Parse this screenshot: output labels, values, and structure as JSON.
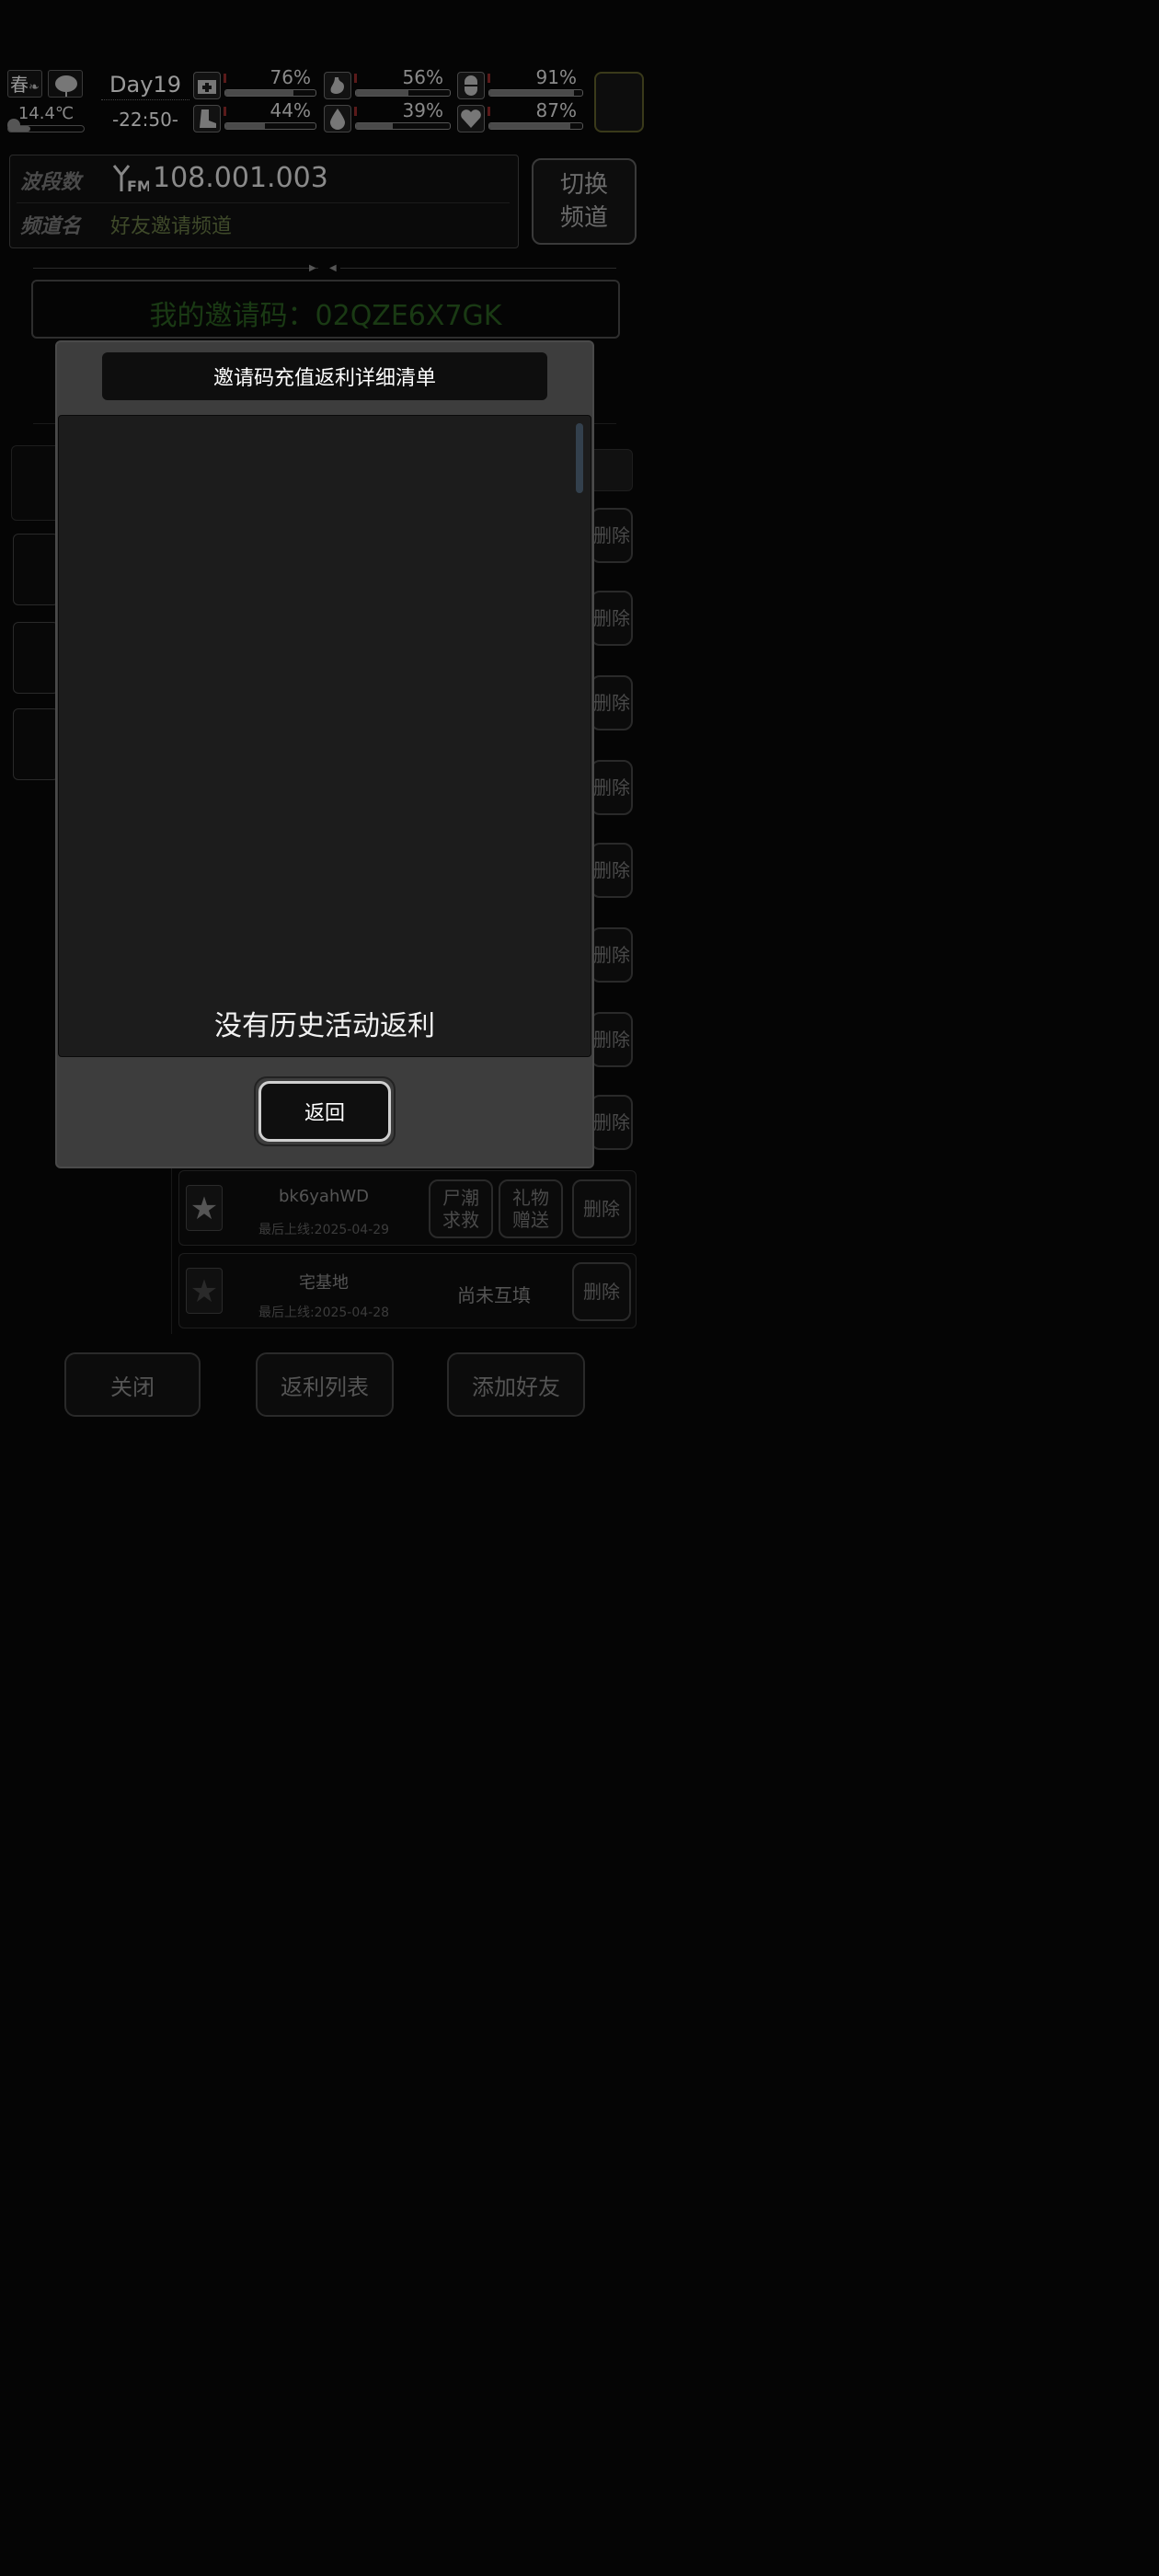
{
  "hud": {
    "season": "春",
    "temperature": "14.4℃",
    "day": "Day19",
    "time": "-22:50-",
    "stats": [
      {
        "icon": "medkit-icon",
        "value": "76%",
        "level": 0.76
      },
      {
        "icon": "stomach-icon",
        "value": "56%",
        "level": 0.56
      },
      {
        "icon": "pill-icon",
        "value": "91%",
        "level": 0.91
      },
      {
        "icon": "boot-icon",
        "value": "44%",
        "level": 0.44
      },
      {
        "icon": "water-drop-icon",
        "value": "39%",
        "level": 0.39
      },
      {
        "icon": "heart-icon",
        "value": "87%",
        "level": 0.87
      }
    ]
  },
  "channel": {
    "freq_label": "波段数",
    "freq_value": "108.001.003",
    "name_label": "频道名",
    "name_value": "好友邀请频道",
    "switch_line1": "切换",
    "switch_line2": "频道"
  },
  "invite": {
    "text": "我的邀请码：02QZE6X7GK"
  },
  "friends": {
    "delete_label": "删除",
    "visible": [
      {
        "name": "bk6yahWD",
        "last_online": "最后上线:2025-04-29",
        "btn1_l1": "尸潮",
        "btn1_l2": "求救",
        "btn2_l1": "礼物",
        "btn2_l2": "赠送"
      },
      {
        "name": "宅基地",
        "last_online": "最后上线:2025-04-28",
        "status": "尚未互填"
      }
    ]
  },
  "bottom": {
    "close": "关闭",
    "rebate_list": "返利列表",
    "add_friend": "添加好友"
  },
  "modal": {
    "title": "邀请码充值返利详细清单",
    "empty_text": "没有历史活动返利",
    "back": "返回"
  }
}
